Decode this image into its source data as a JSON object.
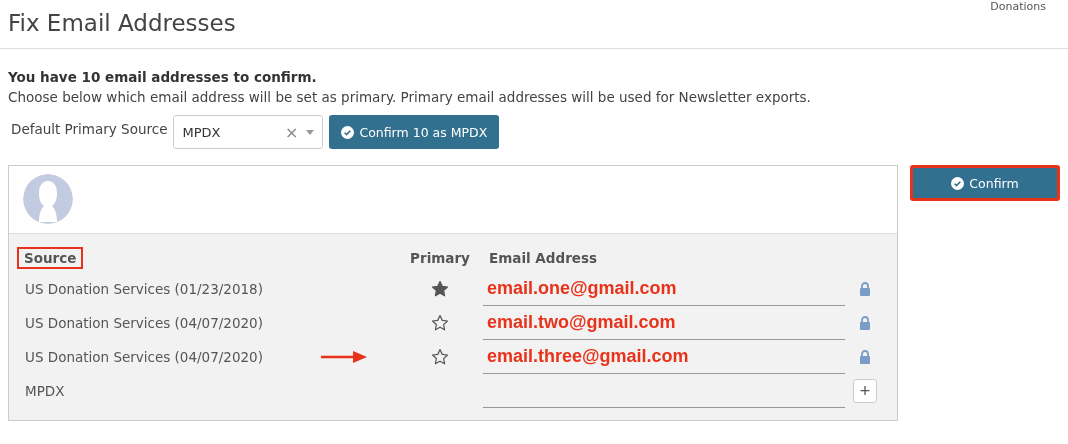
{
  "page": {
    "title": "Fix Email Addresses",
    "corner_text": "Donations"
  },
  "intro": {
    "heading": "You have 10 email addresses to confirm.",
    "description": "Choose below which email address will be set as primary. Primary email addresses will be used for Newsletter exports."
  },
  "default_source": {
    "label": "Default Primary Source",
    "value": "MPDX",
    "clear": "×",
    "button": "Confirm 10 as MPDX"
  },
  "contact": {
    "columns": [
      "Source",
      "Primary",
      "Email Address"
    ],
    "rows": [
      {
        "source": "US Donation Services",
        "date": "(01/23/2018)",
        "selected": true,
        "email": "email.one@gmail.com",
        "locked": true,
        "annotated": false
      },
      {
        "source": "US Donation Services",
        "date": "(04/07/2020)",
        "selected": false,
        "email": "email.two@gmail.com",
        "locked": true,
        "annotated": false
      },
      {
        "source": "US Donation Services",
        "date": "(04/07/2020)",
        "selected": false,
        "email": "email.three@gmail.com",
        "locked": true,
        "annotated": true
      },
      {
        "source": "MPDX",
        "kind": "new",
        "add": "+"
      }
    ],
    "confirm_button": "Confirm"
  }
}
